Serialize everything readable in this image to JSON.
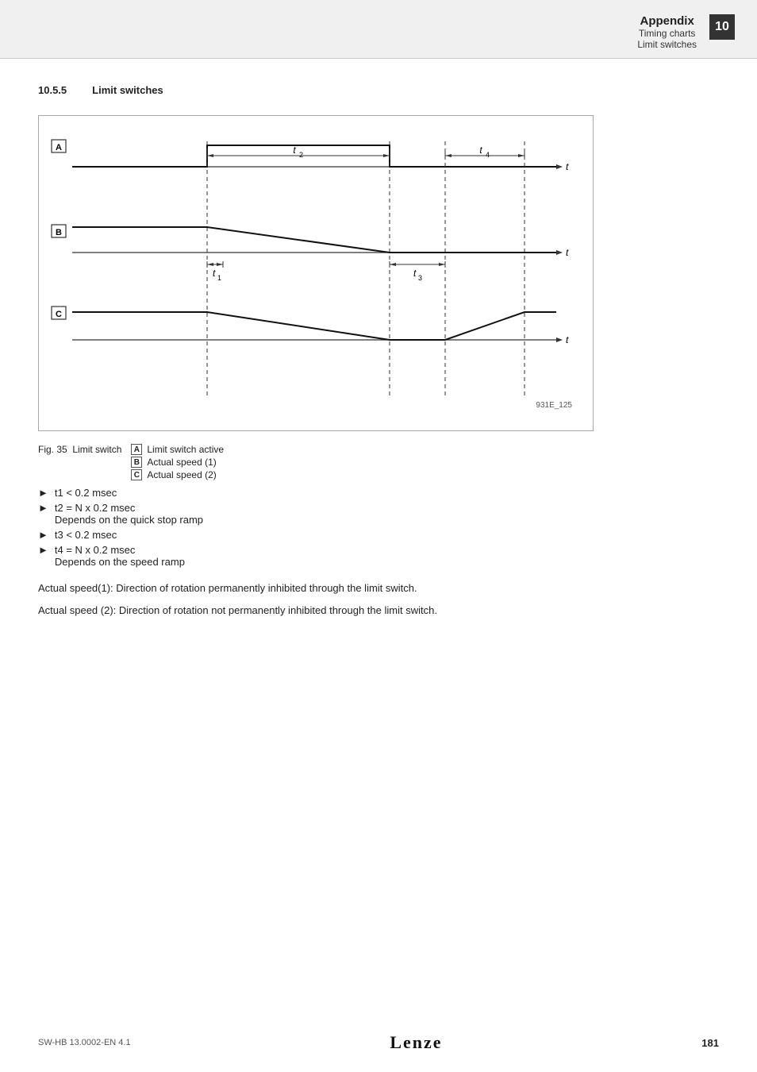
{
  "header": {
    "title": "Appendix",
    "sub1": "Timing charts",
    "sub2": "Limit switches",
    "chapter": "10"
  },
  "section": {
    "number": "10.5.5",
    "title": "Limit switches"
  },
  "figure": {
    "number": "Fig. 35",
    "title": "Limit switch",
    "ref": "931E_125",
    "legend": [
      {
        "key": "A",
        "label": "Limit switch active"
      },
      {
        "key": "B",
        "label": "Actual speed (1)"
      },
      {
        "key": "C",
        "label": "Actual speed (2)"
      }
    ]
  },
  "bullets": [
    {
      "label": "t1 < 0.2 msec",
      "sub": null
    },
    {
      "label": "t2 = N x 0.2 msec",
      "sub": "Depends on the quick stop ramp"
    },
    {
      "label": "t3 < 0.2 msec",
      "sub": null
    },
    {
      "label": "t4 = N x 0.2 msec",
      "sub": "Depends on the speed ramp"
    }
  ],
  "paragraphs": [
    "Actual speed(1): Direction of rotation permanently inhibited through the limit switch.",
    "Actual speed (2): Direction of rotation not permanently inhibited through the limit switch."
  ],
  "footer": {
    "left": "SW-HB 13.0002-EN   4.1",
    "logo": "Lenze",
    "page": "181"
  }
}
